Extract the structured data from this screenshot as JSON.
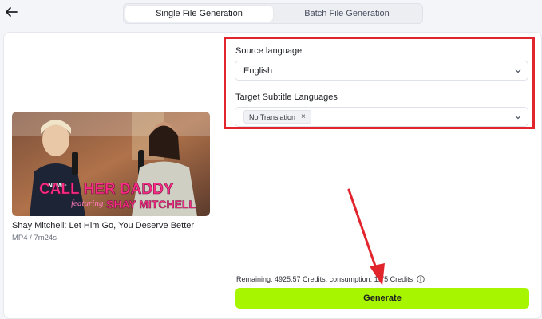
{
  "tabs": [
    {
      "label": "Single File Generation",
      "active": true
    },
    {
      "label": "Batch File Generation",
      "active": false
    }
  ],
  "media": {
    "thumbnail_text": "CALL HER DADDY",
    "thumbnail_subtext": "featuring",
    "thumbnail_name": "SHAY MITCHELL",
    "title": "Shay Mitchell: Let Him Go, You Deserve Better",
    "meta": "MP4 / 7m24s"
  },
  "form": {
    "source_label": "Source language",
    "source_value": "English",
    "target_label": "Target Subtitle Languages",
    "target_chip": "No Translation",
    "chip_remove": "×"
  },
  "footer": {
    "remaining": "Remaining: 4925.57 Credits; consumption: 1.75 Credits",
    "generate_label": "Generate"
  },
  "colors": {
    "accent": "#a8f500",
    "annotation": "#e2252c"
  },
  "icons": [
    "back-arrow-icon",
    "chevron-down-icon",
    "close-icon",
    "info-icon"
  ]
}
